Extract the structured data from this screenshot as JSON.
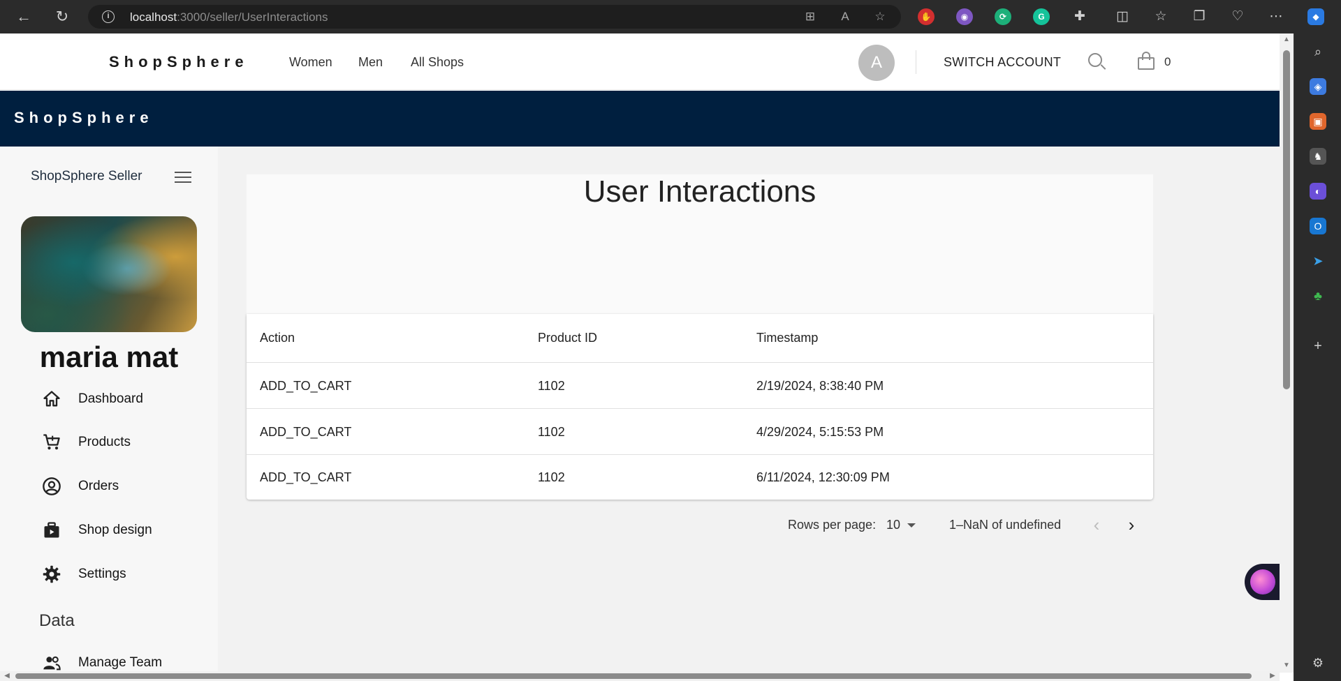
{
  "browser": {
    "url_host": "localhost",
    "url_path": ":3000/seller/UserInteractions"
  },
  "site": {
    "logo": "ShopSphere",
    "nav": [
      "Women",
      "Men",
      "All Shops"
    ],
    "avatar_letter": "A",
    "switch_account": "SWITCH ACCOUNT",
    "cart_count": "0"
  },
  "banner": {
    "logo": "ShopSphere"
  },
  "sidebar": {
    "title": "ShopSphere Seller",
    "user_name": "maria mat",
    "items": [
      {
        "label": "Dashboard",
        "icon": "home-icon"
      },
      {
        "label": "Products",
        "icon": "cart-icon"
      },
      {
        "label": "Orders",
        "icon": "user-circle-icon"
      },
      {
        "label": "Shop design",
        "icon": "video-library-icon"
      },
      {
        "label": "Settings",
        "icon": "gear-icon"
      }
    ],
    "section": "Data",
    "data_items": [
      {
        "label": "Manage Team",
        "icon": "people-icon"
      }
    ]
  },
  "main": {
    "title": "User Interactions",
    "table": {
      "columns": [
        "Action",
        "Product ID",
        "Timestamp"
      ],
      "rows": [
        [
          "ADD_TO_CART",
          "1102",
          "2/19/2024, 8:38:40 PM"
        ],
        [
          "ADD_TO_CART",
          "1102",
          "4/29/2024, 5:15:53 PM"
        ],
        [
          "ADD_TO_CART",
          "1102",
          "6/11/2024, 12:30:09 PM"
        ]
      ]
    },
    "pagination": {
      "rows_per_page_label": "Rows per page:",
      "rows_per_page_value": "10",
      "range_text": "1–NaN of undefined"
    }
  }
}
